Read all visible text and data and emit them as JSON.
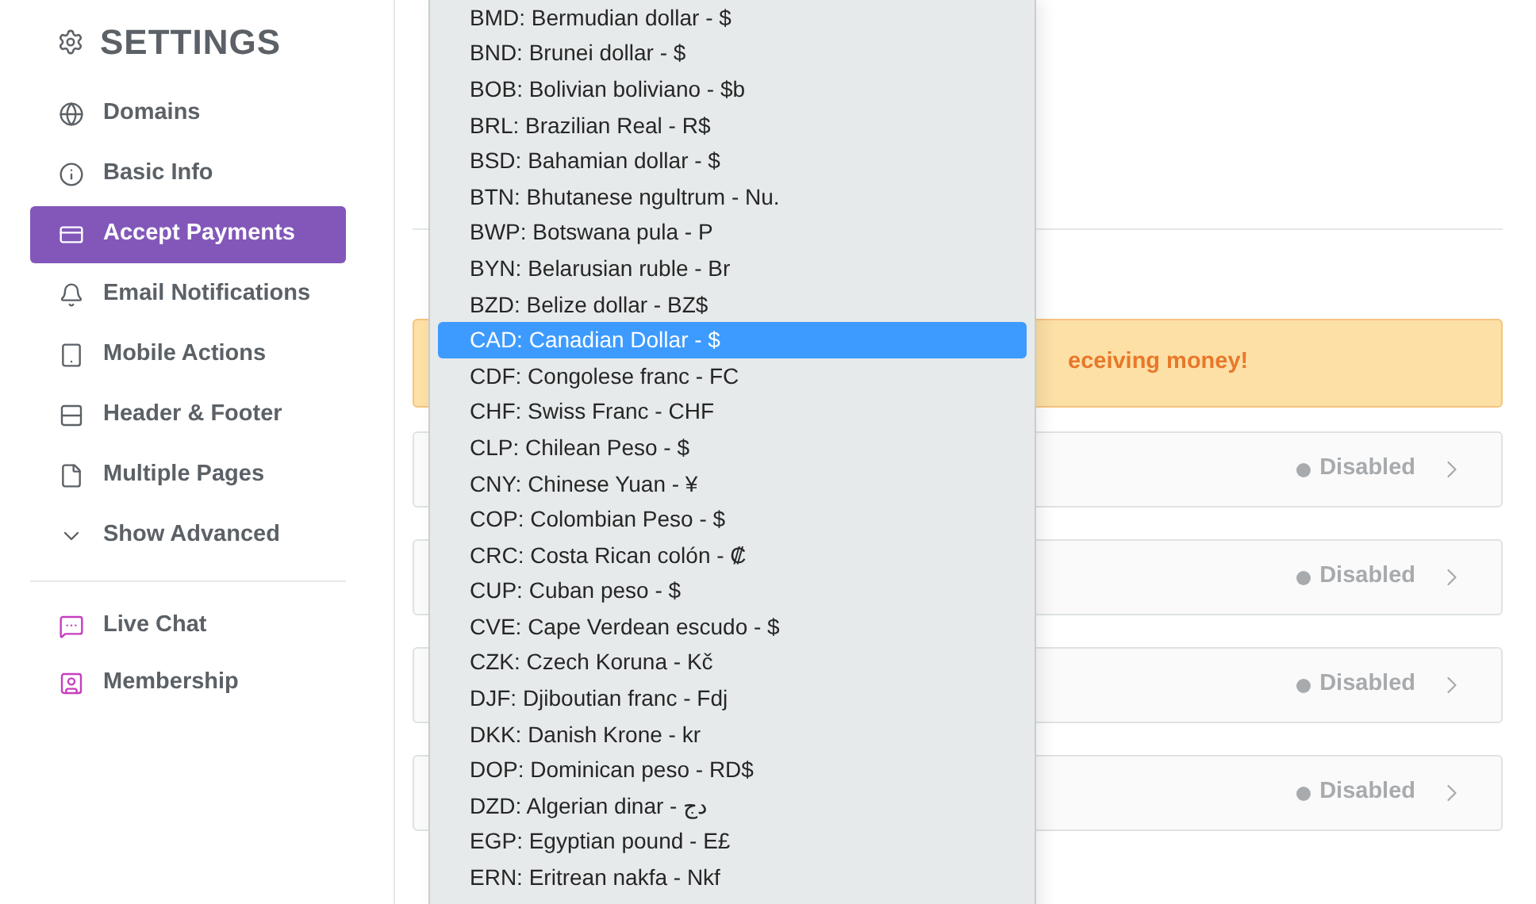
{
  "sidebar": {
    "title": "SETTINGS",
    "items": [
      {
        "label": "Domains",
        "selected": false
      },
      {
        "label": "Basic Info",
        "selected": false
      },
      {
        "label": "Accept Payments",
        "selected": true
      },
      {
        "label": "Email Notifications",
        "selected": false
      },
      {
        "label": "Mobile Actions",
        "selected": false
      },
      {
        "label": "Header & Footer",
        "selected": false
      },
      {
        "label": "Multiple Pages",
        "selected": false
      },
      {
        "label": "Show Advanced",
        "selected": false
      }
    ],
    "apps": [
      {
        "label": "Live Chat"
      },
      {
        "label": "Membership"
      }
    ]
  },
  "alert": {
    "text": "eceiving money!"
  },
  "cards": [
    {
      "status": "Disabled"
    },
    {
      "status": "Disabled"
    },
    {
      "status": "Disabled"
    },
    {
      "status": "Disabled"
    }
  ],
  "dropdown": {
    "options": [
      {
        "label": "BMD: Bermudian dollar - $",
        "selected": false
      },
      {
        "label": "BND: Brunei dollar - $",
        "selected": false
      },
      {
        "label": "BOB: Bolivian boliviano - $b",
        "selected": false
      },
      {
        "label": "BRL: Brazilian Real - R$",
        "selected": false
      },
      {
        "label": "BSD: Bahamian dollar - $",
        "selected": false
      },
      {
        "label": "BTN: Bhutanese ngultrum - Nu.",
        "selected": false
      },
      {
        "label": "BWP: Botswana pula - P",
        "selected": false
      },
      {
        "label": "BYN: Belarusian ruble - Br",
        "selected": false
      },
      {
        "label": "BZD: Belize dollar - BZ$",
        "selected": false
      },
      {
        "label": "CAD: Canadian Dollar - $",
        "selected": true
      },
      {
        "label": "CDF: Congolese franc - FC",
        "selected": false
      },
      {
        "label": "CHF: Swiss Franc - CHF",
        "selected": false
      },
      {
        "label": "CLP: Chilean Peso - $",
        "selected": false
      },
      {
        "label": "CNY: Chinese Yuan - ¥",
        "selected": false
      },
      {
        "label": "COP: Colombian Peso - $",
        "selected": false
      },
      {
        "label": "CRC: Costa Rican colón - ₡",
        "selected": false
      },
      {
        "label": "CUP: Cuban peso - $",
        "selected": false
      },
      {
        "label": "CVE: Cape Verdean escudo - $",
        "selected": false
      },
      {
        "label": "CZK: Czech Koruna - Kč",
        "selected": false
      },
      {
        "label": "DJF: Djiboutian franc - Fdj",
        "selected": false
      },
      {
        "label": "DKK: Danish Krone - kr",
        "selected": false
      },
      {
        "label": "DOP: Dominican peso - RD$",
        "selected": false
      },
      {
        "label": "DZD: Algerian dinar - دج",
        "selected": false
      },
      {
        "label": "EGP: Egyptian pound - E£",
        "selected": false
      },
      {
        "label": "ERN: Eritrean nakfa - Nkf",
        "selected": false
      }
    ]
  }
}
